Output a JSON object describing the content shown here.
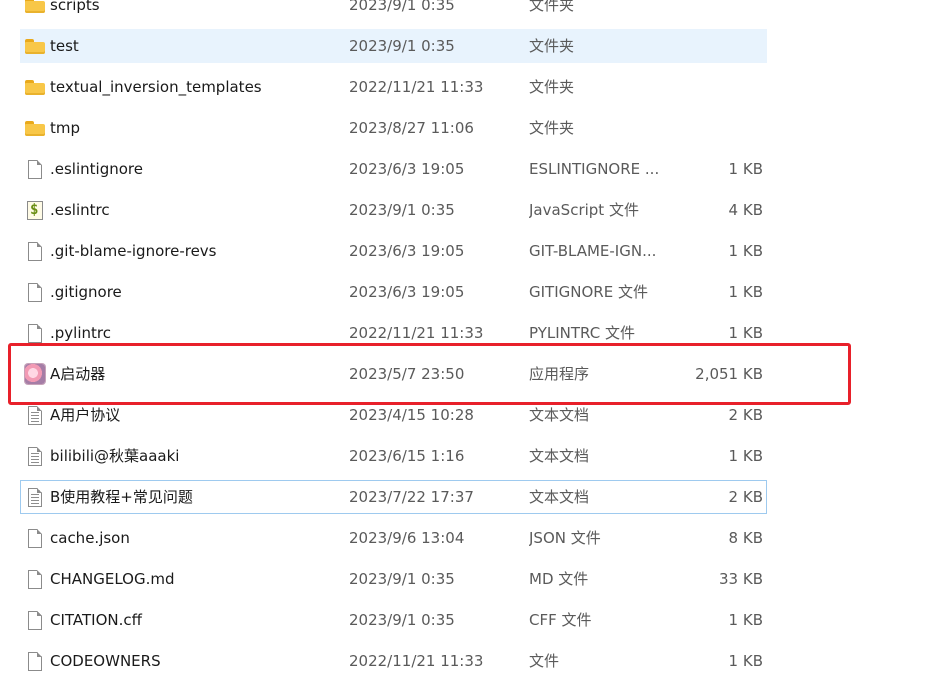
{
  "files": [
    {
      "name": "scripts",
      "date": "2023/9/1 0:35",
      "type": "文件夹",
      "size": "",
      "icon": "folder-icon"
    },
    {
      "name": "test",
      "date": "2023/9/1 0:35",
      "type": "文件夹",
      "size": "",
      "icon": "folder-icon",
      "state": "selected"
    },
    {
      "name": "textual_inversion_templates",
      "date": "2022/11/21 11:33",
      "type": "文件夹",
      "size": "",
      "icon": "folder-icon"
    },
    {
      "name": "tmp",
      "date": "2023/8/27 11:06",
      "type": "文件夹",
      "size": "",
      "icon": "folder-icon"
    },
    {
      "name": ".eslintignore",
      "date": "2023/6/3 19:05",
      "type": "ESLINTIGNORE ...",
      "size": "1 KB",
      "icon": "blank-file-icon"
    },
    {
      "name": ".eslintrc",
      "date": "2023/9/1 0:35",
      "type": "JavaScript 文件",
      "size": "4 KB",
      "icon": "script-file-icon"
    },
    {
      "name": ".git-blame-ignore-revs",
      "date": "2023/6/3 19:05",
      "type": "GIT-BLAME-IGN...",
      "size": "1 KB",
      "icon": "blank-file-icon"
    },
    {
      "name": ".gitignore",
      "date": "2023/6/3 19:05",
      "type": "GITIGNORE 文件",
      "size": "1 KB",
      "icon": "blank-file-icon"
    },
    {
      "name": ".pylintrc",
      "date": "2022/11/21 11:33",
      "type": "PYLINTRC 文件",
      "size": "1 KB",
      "icon": "blank-file-icon"
    },
    {
      "name": "A启动器",
      "date": "2023/5/7 23:50",
      "type": "应用程序",
      "size": "2,051 KB",
      "icon": "app-icon"
    },
    {
      "name": "A用户协议",
      "date": "2023/4/15 10:28",
      "type": "文本文档",
      "size": "2 KB",
      "icon": "text-file-icon"
    },
    {
      "name": "bilibili@秋葉aaaki",
      "date": "2023/6/15 1:16",
      "type": "文本文档",
      "size": "1 KB",
      "icon": "text-file-icon"
    },
    {
      "name": "B使用教程+常见问题",
      "date": "2023/7/22 17:37",
      "type": "文本文档",
      "size": "2 KB",
      "icon": "text-file-icon",
      "state": "focused"
    },
    {
      "name": "cache.json",
      "date": "2023/9/6 13:04",
      "type": "JSON 文件",
      "size": "8 KB",
      "icon": "blank-file-icon"
    },
    {
      "name": "CHANGELOG.md",
      "date": "2023/9/1 0:35",
      "type": "MD 文件",
      "size": "33 KB",
      "icon": "blank-file-icon"
    },
    {
      "name": "CITATION.cff",
      "date": "2023/9/1 0:35",
      "type": "CFF 文件",
      "size": "1 KB",
      "icon": "blank-file-icon"
    },
    {
      "name": "CODEOWNERS",
      "date": "2022/11/21 11:33",
      "type": "文件",
      "size": "1 KB",
      "icon": "blank-file-icon"
    }
  ],
  "highlight_color": "#e8202a"
}
